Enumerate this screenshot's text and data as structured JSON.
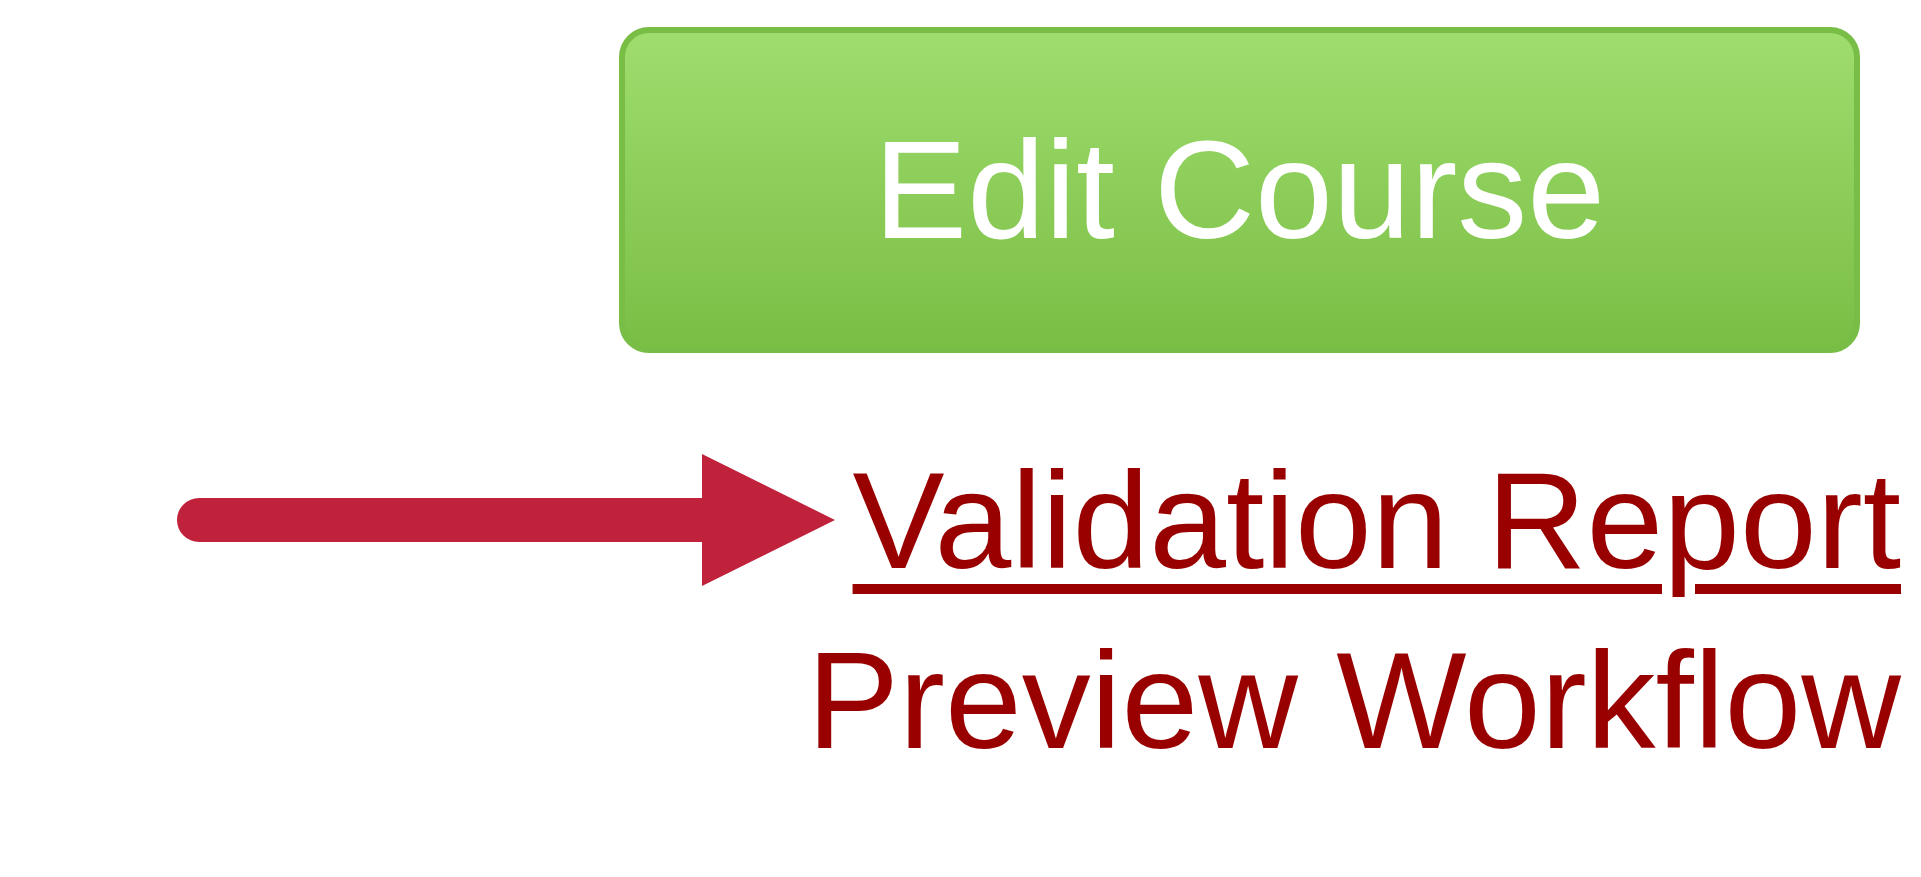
{
  "button": {
    "label": "Edit Course"
  },
  "links": [
    {
      "label": "Validation Report",
      "underlined": true
    },
    {
      "label": "Preview Workflow",
      "underlined": false
    }
  ]
}
